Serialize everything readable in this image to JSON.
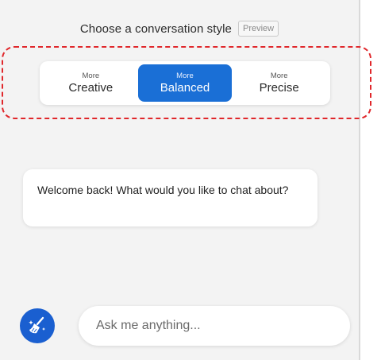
{
  "style_picker": {
    "heading": "Choose a conversation style",
    "badge": "Preview",
    "options": [
      {
        "prefix": "More",
        "label": "Creative",
        "selected": false
      },
      {
        "prefix": "More",
        "label": "Balanced",
        "selected": true
      },
      {
        "prefix": "More",
        "label": "Precise",
        "selected": false
      }
    ]
  },
  "chat": {
    "welcome_message": "Welcome back! What would you like to chat about?"
  },
  "composer": {
    "new_topic_icon": "broom-icon",
    "placeholder": "Ask me anything..."
  },
  "colors": {
    "accent": "#1a6fd6",
    "highlight": "#e0272b",
    "panel_background": "#f3f3f3"
  }
}
